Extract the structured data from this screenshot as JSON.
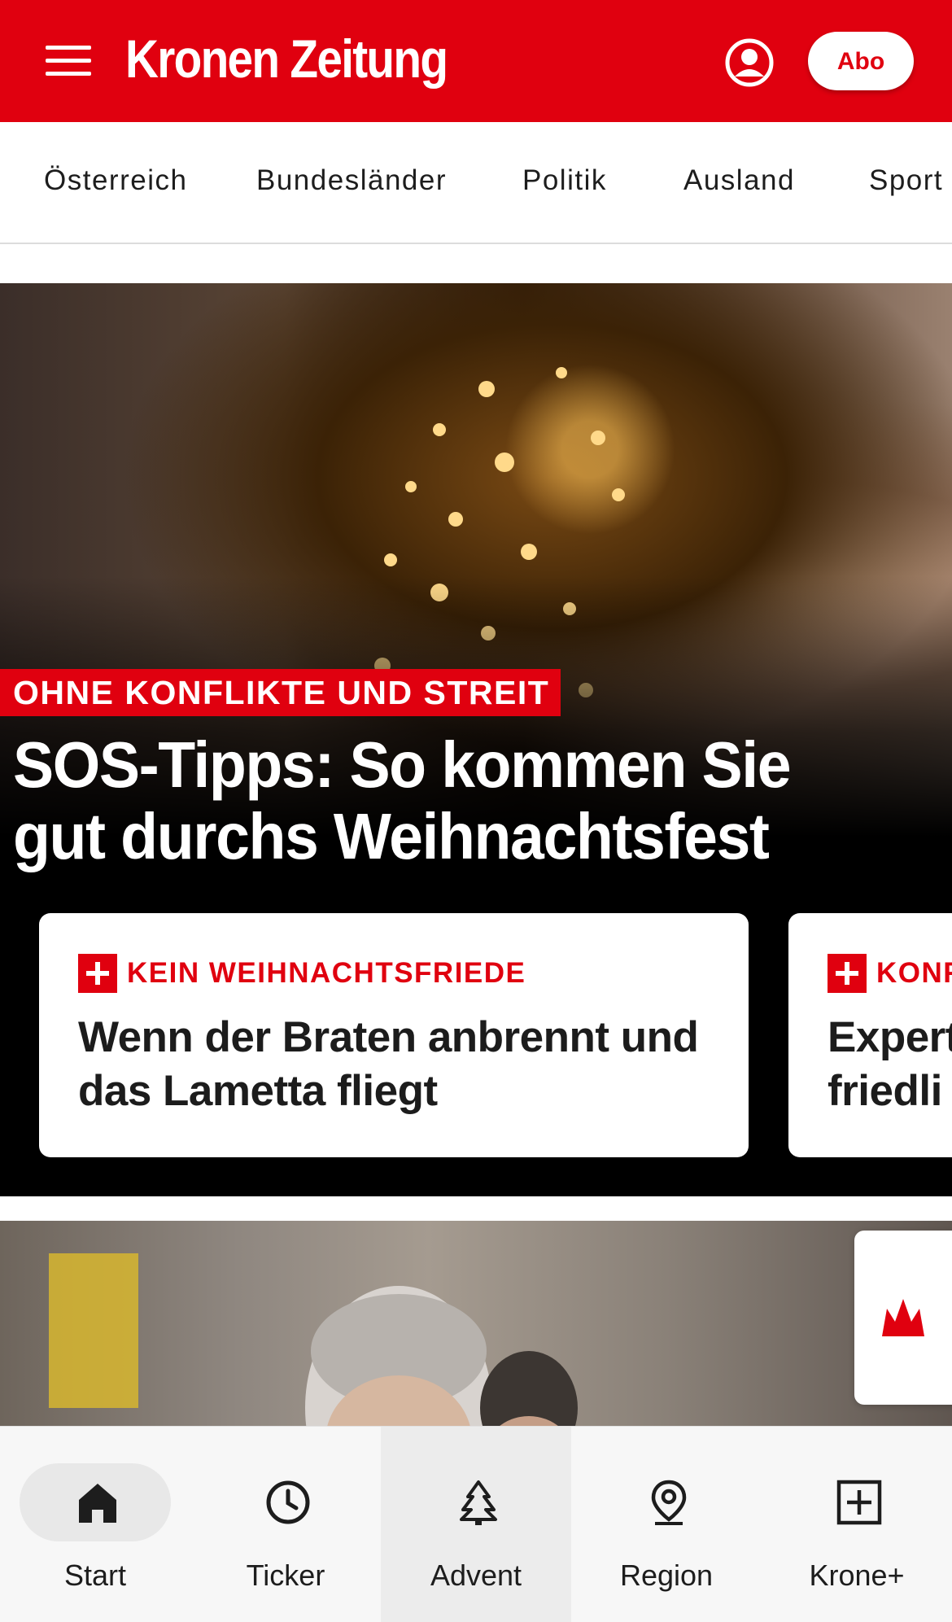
{
  "header": {
    "logo": "Kronen Zeitung",
    "abo_label": "Abo",
    "brand_color": "#e0000f",
    "menu_icon": "hamburger-menu-icon",
    "account_icon": "user-account-icon"
  },
  "sections": [
    {
      "label": "Österreich"
    },
    {
      "label": "Bundesländer"
    },
    {
      "label": "Politik"
    },
    {
      "label": "Ausland"
    },
    {
      "label": "Sport"
    }
  ],
  "hero": {
    "kicker": "OHNE KONFLIKTE UND STREIT",
    "headline": "SOS-Tipps: So kommen Sie gut durchs Weihnachtsfest",
    "cards": [
      {
        "kicker": "KEIN WEIHNACHTSFRIEDE",
        "title": "Wenn der Braten anbrennt und\ndas Lametta fliegt",
        "icon": "krone-plus-icon"
      },
      {
        "kicker": "KONF",
        "title": "Expert\nfriedli",
        "icon": "krone-plus-icon"
      }
    ]
  },
  "side_tab": {
    "icon": "crown-icon"
  },
  "tabbar": {
    "tabs": [
      {
        "label": "Start",
        "icon": "home-icon",
        "selected": true
      },
      {
        "label": "Ticker",
        "icon": "clock-icon"
      },
      {
        "label": "Advent",
        "icon": "christmas-tree-icon"
      },
      {
        "label": "Region",
        "icon": "location-pin-icon"
      },
      {
        "label": "Krone+",
        "icon": "plus-square-icon"
      }
    ]
  }
}
